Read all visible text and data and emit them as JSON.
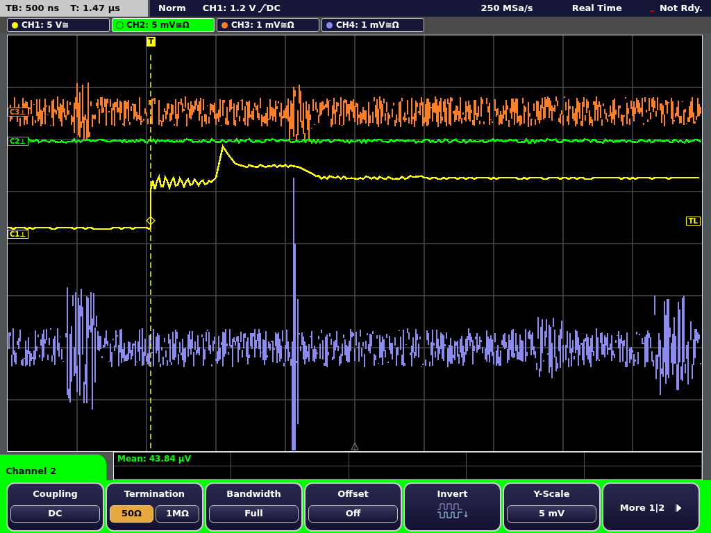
{
  "status_bar": {
    "timebase": "TB: 500 ns",
    "trigger_time": "T: 1.47 µs",
    "mode": "Norm",
    "trigger_source": "CH1: 1.2 V",
    "trigger_coupling": "DC",
    "sample_rate": "250 MSa/s",
    "acquisition": "Real Time",
    "state": "Not Rdy."
  },
  "channel_tabs": [
    {
      "label": "CH1: 5 V≅",
      "color": "#ffff00",
      "selected": false
    },
    {
      "label": "CH2: 5 mV≅Ω",
      "color": "#00ff00",
      "selected": true
    },
    {
      "label": "CH3: 1 mV≅Ω",
      "color": "#ff7f27",
      "selected": false
    },
    {
      "label": "CH4: 1 mV≅Ω",
      "color": "#8c8cf0",
      "selected": false
    }
  ],
  "plot": {
    "trigger_marker": "T",
    "level_marker": "TL",
    "traces": [
      {
        "kind": "noise",
        "color": "#8c8cf0"
      },
      {
        "kind": "noise-high",
        "color": "#ff7f27"
      },
      {
        "kind": "flat",
        "color": "#00ff00"
      },
      {
        "kind": "step",
        "color": "#ffff00"
      }
    ],
    "channel_markers": [
      {
        "label": "C3⊥",
        "color": "#ff7f27",
        "kind": "upper"
      },
      {
        "label": "C2⊥",
        "color": "#00ff00",
        "kind": "middle"
      },
      {
        "label": "C1⊥",
        "color": "#ffff00",
        "kind": "lower"
      }
    ]
  },
  "measurement": {
    "text": "Mean: 43.84 µV"
  },
  "menu": {
    "title": "Channel 2",
    "softkeys": [
      {
        "kind": "value",
        "label": "Coupling",
        "options": [
          {
            "text": "DC"
          }
        ]
      },
      {
        "kind": "choice",
        "label": "Termination",
        "options": [
          {
            "text": "50Ω",
            "selected": true
          },
          {
            "text": "1MΩ",
            "selected": false
          }
        ]
      },
      {
        "kind": "value",
        "label": "Bandwidth",
        "options": [
          {
            "text": "Full"
          }
        ]
      },
      {
        "kind": "value",
        "label": "Offset",
        "options": [
          {
            "text": "Off"
          }
        ]
      },
      {
        "kind": "invert",
        "label": "Invert"
      },
      {
        "kind": "value",
        "label": "Y-Scale",
        "options": [
          {
            "text": "5 mV"
          }
        ]
      },
      {
        "kind": "more",
        "label": "More 1|2"
      }
    ]
  }
}
